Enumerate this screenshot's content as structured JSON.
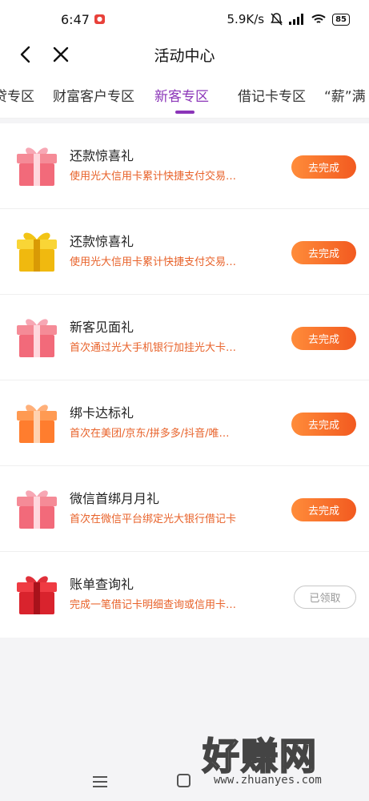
{
  "status_bar": {
    "time": "6:47",
    "speed": "5.9K/s",
    "battery": "85"
  },
  "nav": {
    "title": "活动中心"
  },
  "tabs": [
    {
      "label": "贷专区"
    },
    {
      "label": "财富客户专区"
    },
    {
      "label": "新客专区"
    },
    {
      "label": "借记卡专区"
    },
    {
      "label": "“薪”满"
    }
  ],
  "tasks": [
    {
      "title": "还款惊喜礼",
      "desc": "使用光大信用卡累计快捷支付交易…",
      "button": "去完成",
      "gift": "pink-gift-icon"
    },
    {
      "title": "还款惊喜礼",
      "desc": "使用光大信用卡累计快捷支付交易…",
      "button": "去完成",
      "gift": "gold-gift-icon"
    },
    {
      "title": "新客见面礼",
      "desc": "首次通过光大手机银行加挂光大卡…",
      "button": "去完成",
      "gift": "pink-gift-icon"
    },
    {
      "title": "绑卡达标礼",
      "desc": "首次在美团/京东/拼多多/抖音/唯…",
      "button": "去完成",
      "gift": "orange-gift-icon"
    },
    {
      "title": "微信首绑月月礼",
      "desc": "首次在微信平台绑定光大银行借记卡",
      "button": "去完成",
      "gift": "pink-gift-icon"
    },
    {
      "title": "账单查询礼",
      "desc": "完成一笔借记卡明细查询或信用卡…",
      "button": "已领取",
      "gift": "red-gift-icon"
    }
  ],
  "watermark": {
    "big": "好赚网",
    "small": "www.zhuanyes.com"
  },
  "colors": {
    "accent": "#8b35b8",
    "orange": "#f25a20",
    "desc": "#e8622a"
  }
}
